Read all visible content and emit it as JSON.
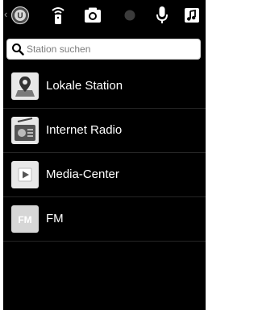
{
  "toolbar": {
    "back": "‹",
    "icons": [
      "app-logo-icon",
      "radio-signal-icon",
      "camera-icon",
      "record-dot-icon",
      "microphone-icon",
      "music-note-icon"
    ],
    "app_logo_letter": "U"
  },
  "search": {
    "placeholder": "Station suchen",
    "value": ""
  },
  "list": {
    "items": [
      {
        "label": "Lokale Station",
        "icon": "location-pin-icon"
      },
      {
        "label": "Internet Radio",
        "icon": "radio-icon"
      },
      {
        "label": "Media-Center",
        "icon": "play-icon"
      },
      {
        "label": "FM",
        "icon": "fm-icon",
        "icon_text": "FM"
      }
    ]
  },
  "colors": {
    "background": "#000000",
    "text": "#ffffff",
    "tile": "#e8e8e8",
    "divider": "#262626"
  }
}
